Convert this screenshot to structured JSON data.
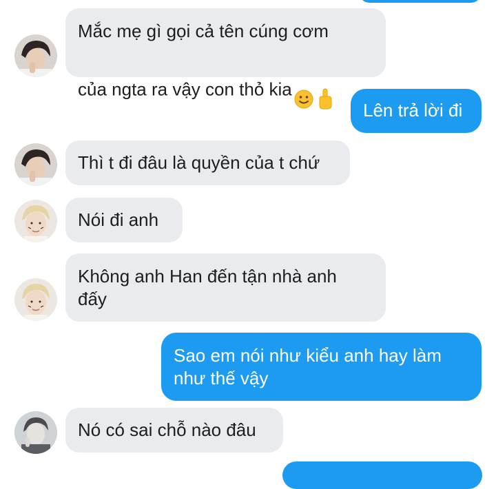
{
  "colors": {
    "incoming_bubble": "#e9ebee",
    "outgoing_bubble": "#1d9bf0",
    "incoming_text": "#1c1e21",
    "outgoing_text": "#ffffff"
  },
  "messages": [
    {
      "side": "incoming",
      "sender_avatar": "avatar-dark-hair",
      "line1": "Mắc mẹ gì gọi cả tên cúng cơm",
      "line2": "của ngta ra vậy con thỏ kia",
      "emojis": [
        "slightly-smiling-face-icon",
        "middle-finger-icon"
      ]
    },
    {
      "side": "outgoing",
      "text": "Lên trả lời đi"
    },
    {
      "side": "incoming",
      "sender_avatar": "avatar-dark-hair",
      "text": "Thì t đi đâu là quyền của t chứ"
    },
    {
      "side": "incoming",
      "sender_avatar": "avatar-blonde-hair",
      "text": "Nói đi anh"
    },
    {
      "side": "incoming",
      "sender_avatar": "avatar-blonde-hair",
      "line1": "Không anh Han đến tận nhà anh",
      "line2": "đấy"
    },
    {
      "side": "outgoing",
      "line1": "Sao em nói như kiểu anh hay làm",
      "line2": "như thế vậy"
    },
    {
      "side": "incoming",
      "sender_avatar": "avatar-grey-photo",
      "text": "Nó có sai chỗ nào đâu"
    }
  ]
}
